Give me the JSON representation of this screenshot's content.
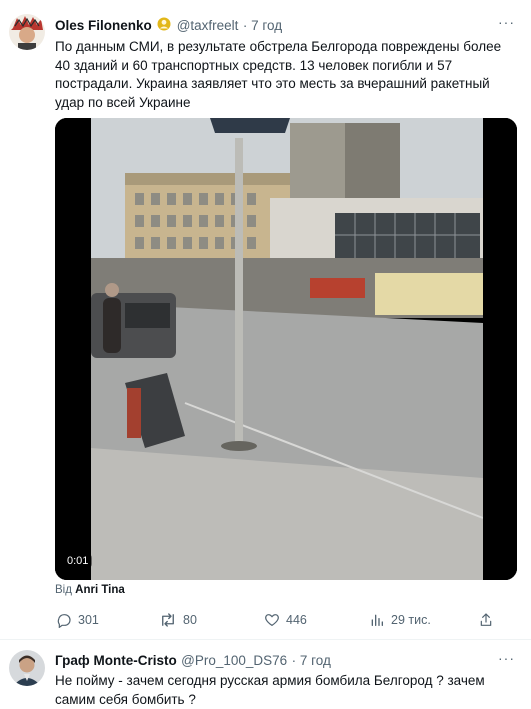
{
  "tweet1": {
    "author": "Oles Filonenko",
    "handle": "@taxfreelt",
    "time": "· 7 год",
    "text": "По данным СМИ, в результате обстрела Белгорода повреждены более 40 зданий и 60 транспортных средств. 13 человек погибли и 57 пострадали. Украина заявляет что это месть за вчерашний ракетный удар по всей Украине",
    "video_time": "0:01",
    "source_prefix": "Від",
    "source_name": "Anri Tina",
    "replies": "301",
    "reposts": "80",
    "likes": "446",
    "views": "29 тис.",
    "more": "···"
  },
  "tweet2": {
    "author": "Граф Monte-Cristo",
    "handle": "@Pro_100_DS76",
    "time": "· 7 год",
    "text": "Не пойму - зачем сегодня русская армия бомбила Белгород ? зачем самим себя бомбить ?",
    "more": "···"
  },
  "colors": {
    "text": "#0f1419",
    "secondary": "#536471",
    "divider": "#eff3f4",
    "verified_gold": "#e2b719"
  }
}
